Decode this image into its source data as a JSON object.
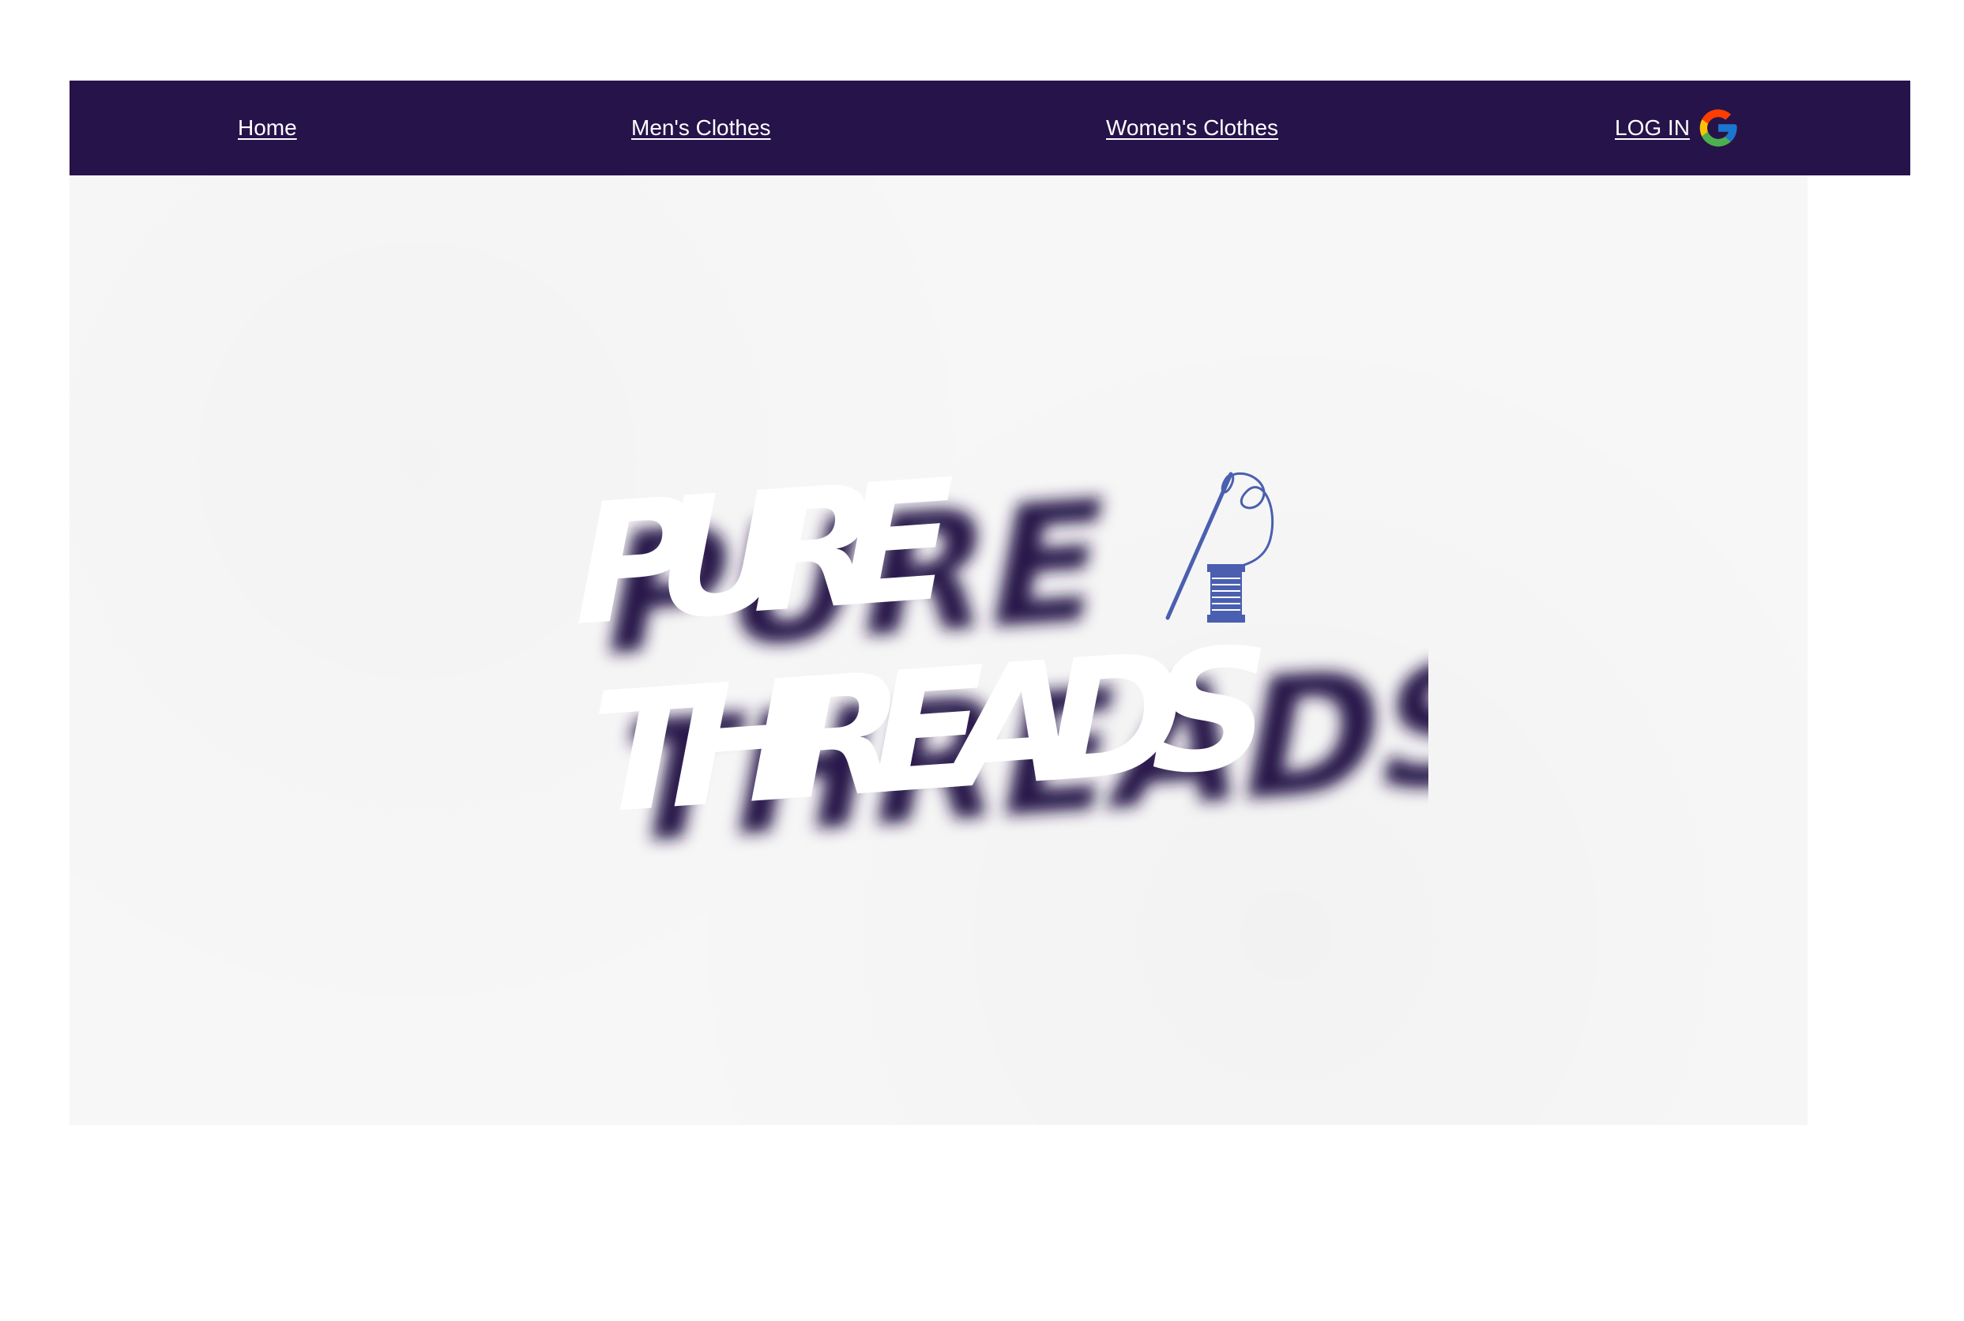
{
  "nav": {
    "home": "Home",
    "mens": "Men's Clothes",
    "womens": "Women's Clothes",
    "login": "LOG IN",
    "login_icon": "google-icon"
  },
  "hero": {
    "logo_line1": "PURE",
    "logo_line2": "THREADS",
    "logo_icon": "needle-spool-icon"
  },
  "colors": {
    "nav_bg": "#26134a",
    "nav_text": "#ffffff",
    "logo_shadow": "#26134a",
    "logo_text": "#ffffff",
    "spool": "#4a5fb0"
  }
}
